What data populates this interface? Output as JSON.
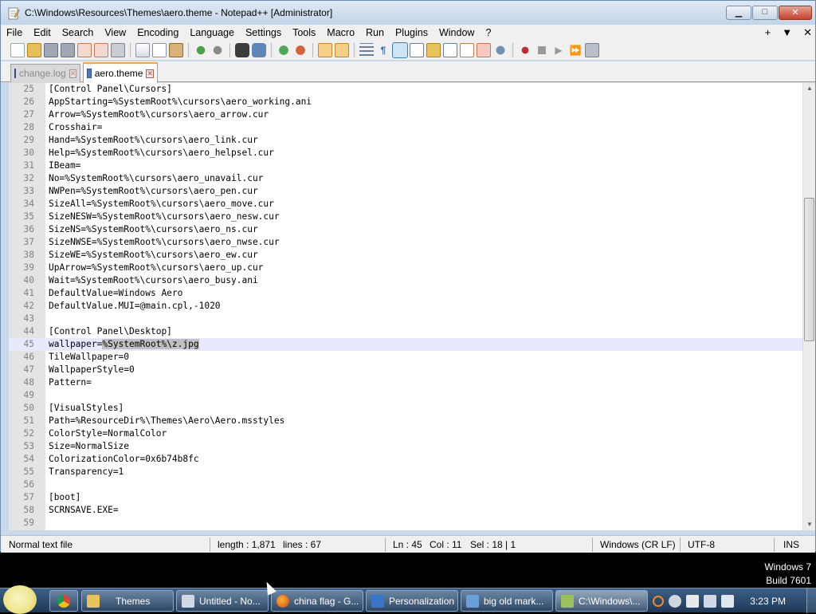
{
  "window": {
    "title": "C:\\Windows\\Resources\\Themes\\aero.theme - Notepad++ [Administrator]",
    "buttons": {
      "minimize": "▁",
      "maximize": "□",
      "close": "✕"
    }
  },
  "menu": {
    "items": [
      "File",
      "Edit",
      "Search",
      "View",
      "Encoding",
      "Language",
      "Settings",
      "Tools",
      "Macro",
      "Run",
      "Plugins",
      "Window",
      "?"
    ],
    "right": [
      "+",
      "▼",
      "✕"
    ]
  },
  "toolbar": {
    "icons": [
      "new-file-icon",
      "open-file-icon",
      "save-icon",
      "save-all-icon",
      "close-icon",
      "close-all-icon",
      "print-icon",
      "cut-icon",
      "copy-icon",
      "paste-icon",
      "undo-icon",
      "redo-icon",
      "find-icon",
      "replace-icon",
      "zoom-in-icon",
      "zoom-out-icon",
      "sync-vertical-icon",
      "sync-horizontal-icon",
      "word-wrap-icon",
      "show-all-chars-icon",
      "indent-guide-icon",
      "user-lang-icon",
      "doc-map-icon",
      "function-list-icon",
      "folder-workspace-icon",
      "monitor-icon",
      "record-macro-icon",
      "stop-macro-icon",
      "play-macro-icon",
      "run-macro-multiple-icon",
      "save-macro-icon"
    ]
  },
  "tabs": [
    {
      "label": "change.log",
      "active": false
    },
    {
      "label": "aero.theme",
      "active": true
    }
  ],
  "editor": {
    "lines": [
      {
        "n": "25",
        "text": "[Control Panel\\Cursors]"
      },
      {
        "n": "26",
        "text": "AppStarting=%SystemRoot%\\cursors\\aero_working.ani"
      },
      {
        "n": "27",
        "text": "Arrow=%SystemRoot%\\cursors\\aero_arrow.cur"
      },
      {
        "n": "28",
        "text": "Crosshair="
      },
      {
        "n": "29",
        "text": "Hand=%SystemRoot%\\cursors\\aero_link.cur"
      },
      {
        "n": "30",
        "text": "Help=%SystemRoot%\\cursors\\aero_helpsel.cur"
      },
      {
        "n": "31",
        "text": "IBeam="
      },
      {
        "n": "32",
        "text": "No=%SystemRoot%\\cursors\\aero_unavail.cur"
      },
      {
        "n": "33",
        "text": "NWPen=%SystemRoot%\\cursors\\aero_pen.cur"
      },
      {
        "n": "34",
        "text": "SizeAll=%SystemRoot%\\cursors\\aero_move.cur"
      },
      {
        "n": "35",
        "text": "SizeNESW=%SystemRoot%\\cursors\\aero_nesw.cur"
      },
      {
        "n": "36",
        "text": "SizeNS=%SystemRoot%\\cursors\\aero_ns.cur"
      },
      {
        "n": "37",
        "text": "SizeNWSE=%SystemRoot%\\cursors\\aero_nwse.cur"
      },
      {
        "n": "38",
        "text": "SizeWE=%SystemRoot%\\cursors\\aero_ew.cur"
      },
      {
        "n": "39",
        "text": "UpArrow=%SystemRoot%\\cursors\\aero_up.cur"
      },
      {
        "n": "40",
        "text": "Wait=%SystemRoot%\\cursors\\aero_busy.ani"
      },
      {
        "n": "41",
        "text": "DefaultValue=Windows Aero"
      },
      {
        "n": "42",
        "text": "DefaultValue.MUI=@main.cpl,-1020"
      },
      {
        "n": "43",
        "text": ""
      },
      {
        "n": "44",
        "text": "[Control Panel\\Desktop]"
      },
      {
        "n": "45",
        "text": "wallpaper=",
        "selected": "%SystemRoot%\\z.jpg",
        "current": true
      },
      {
        "n": "46",
        "text": "TileWallpaper=0"
      },
      {
        "n": "47",
        "text": "WallpaperStyle=0"
      },
      {
        "n": "48",
        "text": "Pattern="
      },
      {
        "n": "49",
        "text": ""
      },
      {
        "n": "50",
        "text": "[VisualStyles]"
      },
      {
        "n": "51",
        "text": "Path=%ResourceDir%\\Themes\\Aero\\Aero.msstyles"
      },
      {
        "n": "52",
        "text": "ColorStyle=NormalColor"
      },
      {
        "n": "53",
        "text": "Size=NormalSize"
      },
      {
        "n": "54",
        "text": "ColorizationColor=0x6b74b8fc"
      },
      {
        "n": "55",
        "text": "Transparency=1"
      },
      {
        "n": "56",
        "text": ""
      },
      {
        "n": "57",
        "text": "[boot]"
      },
      {
        "n": "58",
        "text": "SCRNSAVE.EXE="
      },
      {
        "n": "59",
        "text": ""
      }
    ]
  },
  "status": {
    "file_type": "Normal text file",
    "length": "length : 1,871",
    "lines": "lines : 67",
    "ln": "Ln : 45",
    "col": "Col : 11",
    "sel": "Sel : 18 | 1",
    "eol": "Windows (CR LF)",
    "encoding": "UTF-8",
    "mode": "INS"
  },
  "desktop": {
    "os_line1": "Windows 7",
    "os_line2": "Build 7601"
  },
  "taskbar": {
    "items": [
      {
        "label": "",
        "icon": "chrome-icon",
        "color": "#e04a3a"
      },
      {
        "label": "Themes",
        "icon": "folder-icon",
        "color": "#e8c35a"
      },
      {
        "label": "Untitled - No...",
        "icon": "notepad-icon",
        "color": "#cfd8e4"
      },
      {
        "label": "china flag - G...",
        "icon": "firefox-icon",
        "color": "#e8701c"
      },
      {
        "label": "Personalization",
        "icon": "personalization-icon",
        "color": "#3a76c8"
      },
      {
        "label": "big old mark...",
        "icon": "window-icon",
        "color": "#6aa0d8"
      },
      {
        "label": "C:\\Windows\\...",
        "icon": "notepadpp-icon",
        "color": "#9ac15a",
        "active": true
      }
    ],
    "clock": "3:23 PM"
  },
  "colors": {
    "selection": "#c0c0c0",
    "current_line": "#e8e8ff",
    "tab_accent": "#f9a53c"
  }
}
